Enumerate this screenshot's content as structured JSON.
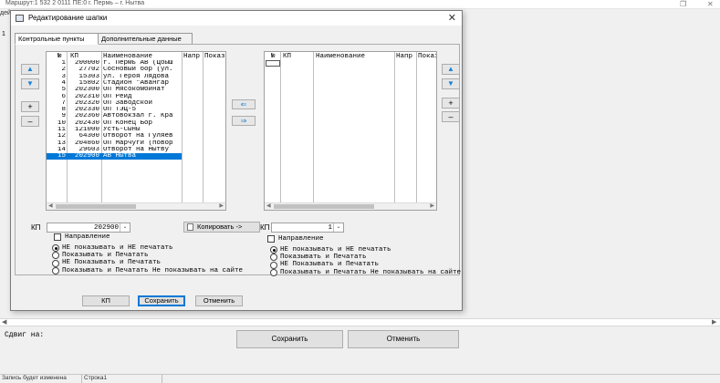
{
  "window": {
    "title": "Маршрут:1 532 2     0111 ПЕ:0 г. Пермь – г. Нытва",
    "left_tab_fragment": "дей",
    "left_marker": "1",
    "shift_label": "Сдвиг на:",
    "save_label": "Сохранить",
    "cancel_label": "Отменить",
    "status": [
      "Запись будет изменена",
      "Строка1"
    ]
  },
  "dialog": {
    "title": "Редактирование шапки",
    "tabs": [
      "Контрольные пункты",
      "Дополнительные данные"
    ],
    "left_grid": {
      "columns": [
        "№",
        "КП",
        "Наименование",
        "Напр",
        "Показ"
      ],
      "rows": [
        [
          "1",
          "200000",
          "г. Пермь АВ (Цбыш"
        ],
        [
          "2",
          "27702",
          "Сосновый бор (ул."
        ],
        [
          "3",
          "15303",
          "ул. Героя Лядова"
        ],
        [
          "4",
          "15802",
          "Стадион \"Авангар"
        ],
        [
          "5",
          "202300",
          "ОП Мясокомбинат"
        ],
        [
          "6",
          "202310",
          "ОП Рейд"
        ],
        [
          "7",
          "202320",
          "ОП Заводской"
        ],
        [
          "8",
          "202330",
          "ОП ТЭЦ-5"
        ],
        [
          "9",
          "202360",
          "Автовокзал г. Кра"
        ],
        [
          "10",
          "202430",
          "ОП Конец Бор"
        ],
        [
          "11",
          "121000",
          "Усть-Сыны"
        ],
        [
          "12",
          "64300",
          "Отворот на Гуляев"
        ],
        [
          "13",
          "204860",
          "ОП Марчуги (повор"
        ],
        [
          "14",
          "29603",
          "Отворот на Нытву"
        ],
        [
          "15",
          "202900",
          "АВ Нытва"
        ]
      ],
      "selected_row": 15
    },
    "right_grid": {
      "columns": [
        "№",
        "КП",
        "Наименование",
        "Напр",
        "Показ"
      ]
    },
    "kp_label": "КП",
    "left_kp_value": "202900",
    "copy_label": "Копировать ->",
    "right_kp_value": "1",
    "direction_label": "Направление",
    "options": [
      "НЕ показывать и НЕ печатать",
      "Показывать и Печатать",
      "НЕ Показывать и Печатать",
      "Показывать и Печатать Не показывать на сайте"
    ],
    "left_selected_option": 0,
    "right_selected_option": 0,
    "footer": {
      "kp": "КП",
      "save": "Сохранить",
      "cancel": "Отменить"
    }
  },
  "icons": {
    "up": "▲",
    "down": "▼",
    "plus": "+",
    "minus": "–",
    "arrow_left": "⇐",
    "arrow_right": "⇒",
    "close": "✕",
    "dropdown": "⌄"
  },
  "colors": {
    "selection": "#0078d7",
    "arrow_blue": "#1a82d6"
  }
}
